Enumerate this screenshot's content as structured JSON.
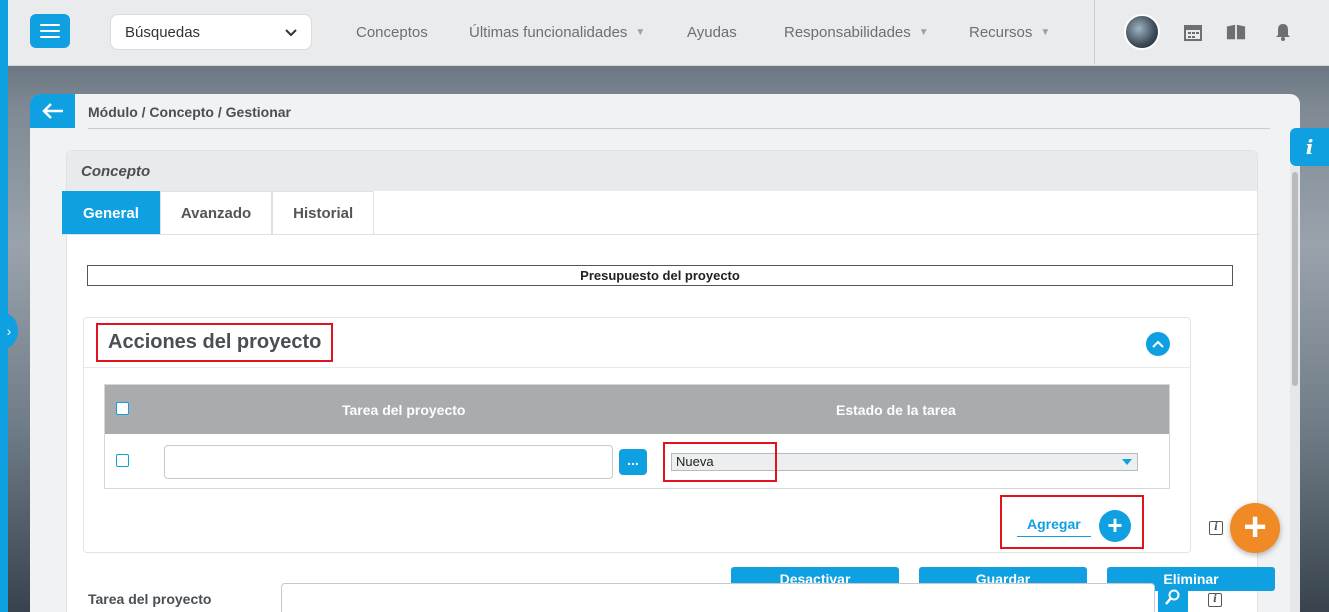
{
  "topbar": {
    "search_select": "Búsquedas",
    "nav": [
      {
        "label": "Conceptos",
        "has_caret": false
      },
      {
        "label": "Últimas funcionalidades",
        "has_caret": true
      },
      {
        "label": "Ayudas",
        "has_caret": false
      },
      {
        "label": "Responsabilidades",
        "has_caret": true
      },
      {
        "label": "Recursos",
        "has_caret": true
      }
    ],
    "icons": [
      "calendar-icon",
      "book-icon",
      "bell-icon"
    ]
  },
  "breadcrumb": "Módulo / Concepto / Gestionar",
  "concept": {
    "title": "Concepto",
    "tabs": [
      "General",
      "Avanzado",
      "Historial"
    ],
    "active_tab": "General"
  },
  "budget_header": "Presupuesto del proyecto",
  "actions": {
    "title": "Acciones del proyecto",
    "columns": [
      "Tarea del proyecto",
      "Estado de la tarea"
    ],
    "row": {
      "task": "",
      "dots": "...",
      "state": "Nueva"
    },
    "add_label": "Agregar"
  },
  "buttons": {
    "deactivate": "Desactivar",
    "save": "Guardar",
    "delete": "Eliminar"
  },
  "bottom": {
    "task_label": "Tarea del proyecto"
  },
  "colors": {
    "accent": "#0ea0e0",
    "highlight": "#e0141e",
    "fab": "#f08a24"
  }
}
